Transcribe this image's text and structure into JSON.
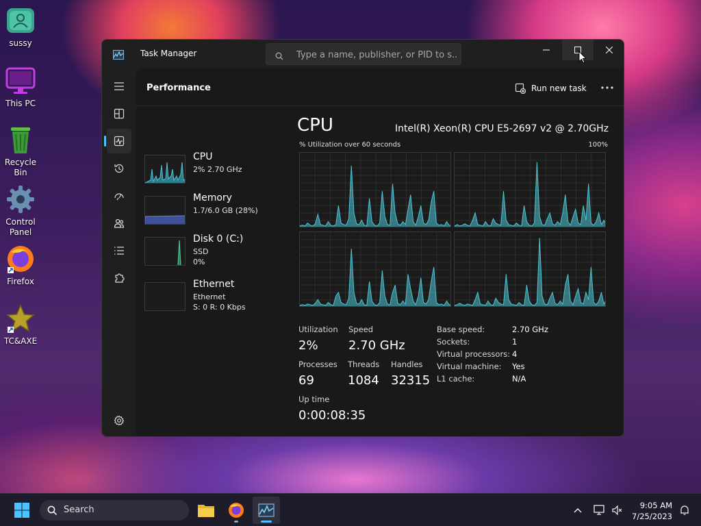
{
  "desktop": {
    "icons": [
      {
        "label": "sussy",
        "icon": "user-folder-icon"
      },
      {
        "label": "This PC",
        "icon": "monitor-icon"
      },
      {
        "label": "Recycle Bin",
        "icon": "recycle-bin-icon"
      },
      {
        "label": "Control Panel",
        "icon": "gear-icon"
      },
      {
        "label": "Firefox",
        "icon": "firefox-icon"
      },
      {
        "label": "TC&AXE",
        "icon": "star-icon"
      }
    ]
  },
  "window": {
    "title": "Task Manager",
    "search_placeholder": "Type a name, publisher, or PID to s..."
  },
  "performance": {
    "section_title": "Performance",
    "run_new_task": "Run new task",
    "devices": [
      {
        "name": "CPU",
        "line1": "2% 2.70 GHz",
        "line2": ""
      },
      {
        "name": "Memory",
        "line1": "1.7/6.0 GB (28%)",
        "line2": ""
      },
      {
        "name": "Disk 0 (C:)",
        "line1": "SSD",
        "line2": "0%"
      },
      {
        "name": "Ethernet",
        "line1": "Ethernet",
        "line2": "S: 0 R: 0 Kbps"
      }
    ],
    "cpu": {
      "heading": "CPU",
      "model": "Intel(R) Xeon(R) CPU E5-2697 v2 @ 2.70GHz",
      "graph_caption": "% Utilization over 60 seconds",
      "graph_max": "100%",
      "stats": {
        "utilization_label": "Utilization",
        "utilization": "2%",
        "speed_label": "Speed",
        "speed": "2.70 GHz",
        "processes_label": "Processes",
        "processes": "69",
        "threads_label": "Threads",
        "threads": "1084",
        "handles_label": "Handles",
        "handles": "32315",
        "uptime_label": "Up time",
        "uptime": "0:00:08:35"
      },
      "details": [
        {
          "key": "Base speed:",
          "value": "2.70 GHz"
        },
        {
          "key": "Sockets:",
          "value": "1"
        },
        {
          "key": "Virtual processors:",
          "value": "4"
        },
        {
          "key": "Virtual machine:",
          "value": "Yes"
        },
        {
          "key": "L1 cache:",
          "value": "N/A"
        }
      ]
    }
  },
  "taskbar": {
    "search_label": "Search",
    "time": "9:05 AM",
    "date": "7/25/2023"
  },
  "colors": {
    "accent": "#4cc2ff",
    "cpu_graph": "#4fc4d4",
    "memory_graph": "#6a7fe0",
    "disk_graph": "#4ec28a",
    "ethernet_graph": "#d46aa8"
  }
}
